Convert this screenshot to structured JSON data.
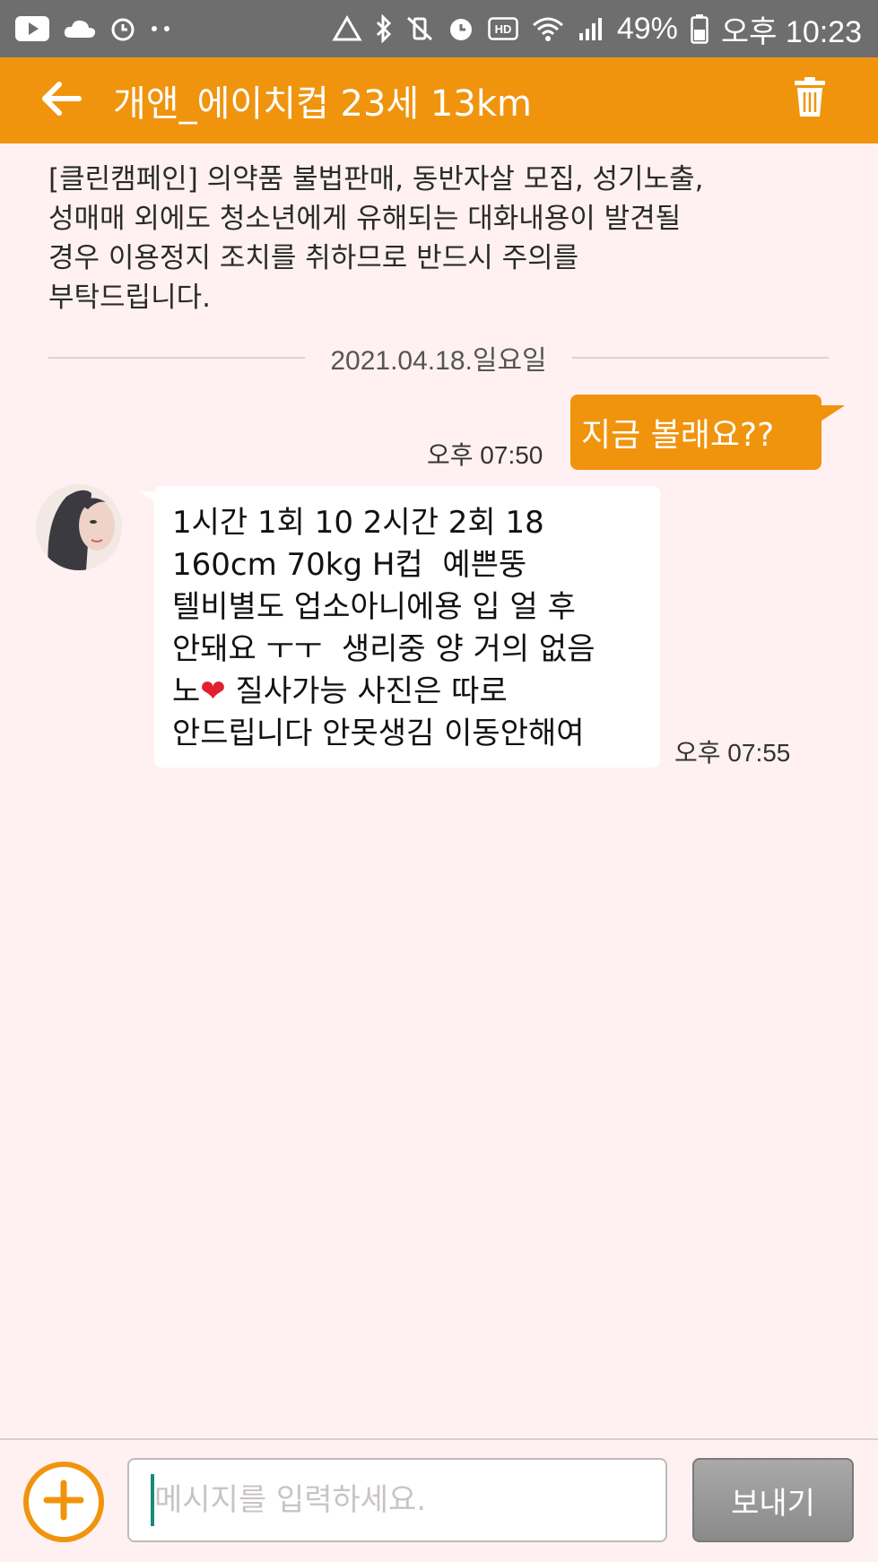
{
  "status_bar": {
    "battery_percent": "49%",
    "time": "오후 10:23",
    "icons": [
      "youtube-icon",
      "cloud-icon",
      "alarm-icon",
      "more-dots-icon",
      "recycle-icon",
      "bluetooth-icon",
      "vibrate-off-icon",
      "alarm-clock-icon",
      "hd-icon",
      "wifi-icon",
      "signal-icon",
      "battery-icon"
    ]
  },
  "header": {
    "title": "개앤_에이치컵 23세 13km",
    "back_icon": "back-arrow-icon",
    "delete_icon": "trash-icon",
    "color": "#f0940e"
  },
  "notice": {
    "text": "[클린캠페인] 의약품 불법판매, 동반자살 모집, 성기노출,\n성매매 외에도 청소년에게 유해되는 대화내용이 발견될\n경우 이용정지 조치를 취하므로 반드시 주의를\n부탁드립니다."
  },
  "date_divider": {
    "label": "2021.04.18.일요일"
  },
  "messages": {
    "outgoing": {
      "text": "지금 볼래요??",
      "time": "오후 07:50"
    },
    "incoming": {
      "lines": [
        "1시간 1회 10 2시간 2회 18",
        "160cm 70kg H컵  예쁜뚱",
        "텔비별도 업소아니에용 입 얼 후",
        "안돼요 ㅜㅜ  생리중 양 거의 없음",
        "노",
        " 질사가능 사진은 따로",
        "안드립니다 안못생김 이동안해여"
      ],
      "heart": "❤",
      "time": "오후 07:55"
    }
  },
  "composer": {
    "placeholder": "메시지를 입력하세요.",
    "value": "",
    "send_label": "보내기"
  }
}
